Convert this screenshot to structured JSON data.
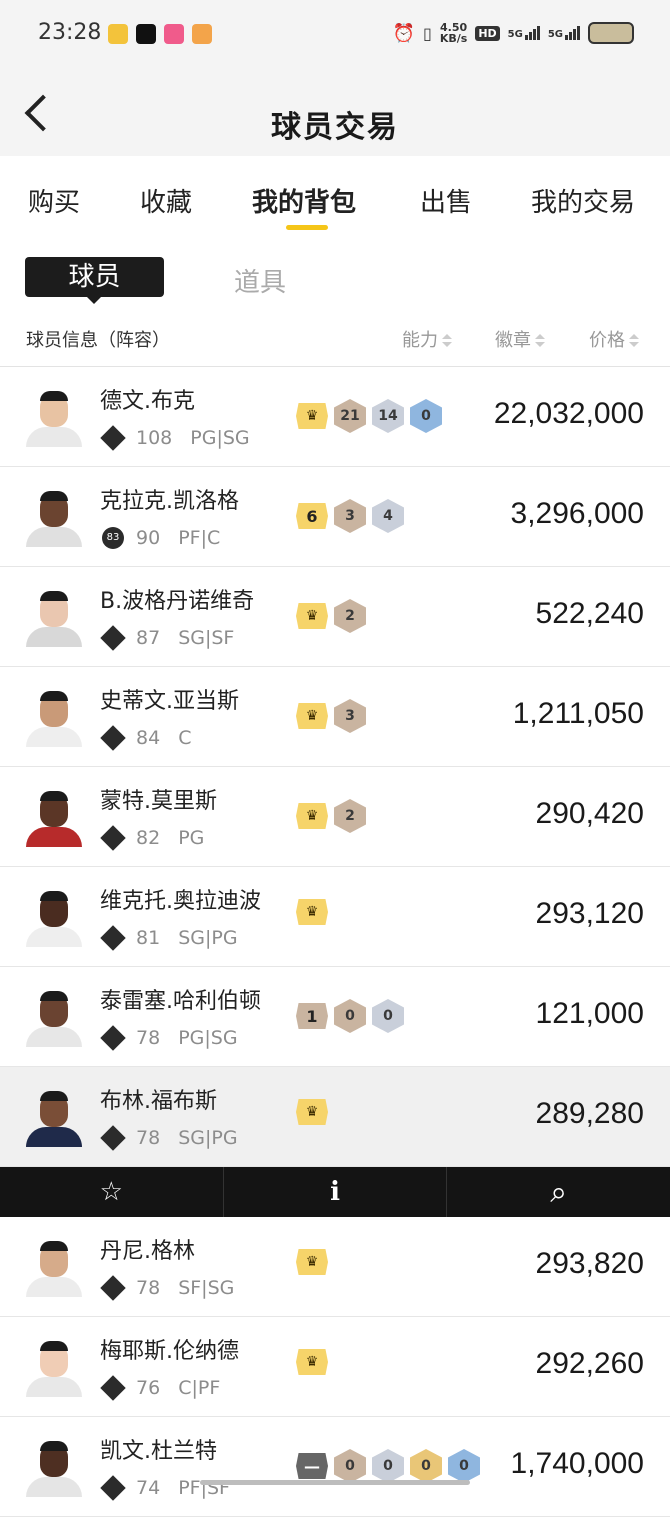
{
  "status_bar": {
    "time": "23:28",
    "net_speed_top": "4.50",
    "net_speed_bottom": "KB/s",
    "hd": "HD",
    "sim1": "5G",
    "sim2": "5G"
  },
  "header": {
    "title": "球员交易",
    "back_icon": "chevron-left-icon"
  },
  "tabs": [
    {
      "label": "购买"
    },
    {
      "label": "收藏"
    },
    {
      "label": "我的背包"
    },
    {
      "label": "出售"
    },
    {
      "label": "我的交易"
    }
  ],
  "active_tab": "我的背包",
  "subtabs": {
    "active": "球员",
    "inactive": "道具"
  },
  "columns": {
    "info": "球员信息（阵容）",
    "ability": "能力",
    "badge": "徽章",
    "price": "价格"
  },
  "players": [
    {
      "name": "德文.布克",
      "ovr": "108",
      "pos": "PG|SG",
      "badges": [
        {
          "k": "crown"
        },
        {
          "k": "hex",
          "c": "bronze",
          "v": "21"
        },
        {
          "k": "hex",
          "c": "silver",
          "v": "14"
        },
        {
          "k": "hex",
          "c": "blue",
          "v": "0"
        }
      ],
      "price": "22,032,000",
      "skin": "#e8c3a3",
      "jersey": "#e9e9e9"
    },
    {
      "name": "克拉克.凯洛格",
      "ovr": "90",
      "pos": "PF|C",
      "rank_round": "83",
      "badges": [
        {
          "k": "rank",
          "c": "gold",
          "v": "6"
        },
        {
          "k": "hex",
          "c": "bronze",
          "v": "3"
        },
        {
          "k": "hex",
          "c": "silver",
          "v": "4"
        }
      ],
      "price": "3,296,000",
      "skin": "#6b4430",
      "jersey": "#e0e0e0"
    },
    {
      "name": "B.波格丹诺维奇",
      "ovr": "87",
      "pos": "SG|SF",
      "badges": [
        {
          "k": "crown"
        },
        {
          "k": "hex",
          "c": "bronze",
          "v": "2"
        }
      ],
      "price": "522,240",
      "skin": "#eac7b0",
      "jersey": "#d8d8d8"
    },
    {
      "name": "史蒂文.亚当斯",
      "ovr": "84",
      "pos": "C",
      "badges": [
        {
          "k": "crown"
        },
        {
          "k": "hex",
          "c": "bronze",
          "v": "3"
        }
      ],
      "price": "1,211,050",
      "skin": "#c99a78",
      "jersey": "#eeeeee"
    },
    {
      "name": "蒙特.莫里斯",
      "ovr": "82",
      "pos": "PG",
      "badges": [
        {
          "k": "crown"
        },
        {
          "k": "hex",
          "c": "bronze",
          "v": "2"
        }
      ],
      "price": "290,420",
      "skin": "#5b3626",
      "jersey": "#b72b2b"
    },
    {
      "name": "维克托.奥拉迪波",
      "ovr": "81",
      "pos": "SG|PG",
      "badges": [
        {
          "k": "crown"
        }
      ],
      "price": "293,120",
      "skin": "#4a2c20",
      "jersey": "#eeeeee"
    },
    {
      "name": "泰雷塞.哈利伯顿",
      "ovr": "78",
      "pos": "PG|SG",
      "badges": [
        {
          "k": "rank",
          "c": "bronze",
          "v": "1"
        },
        {
          "k": "hex",
          "c": "bronze",
          "v": "0"
        },
        {
          "k": "hex",
          "c": "silver",
          "v": "0"
        }
      ],
      "price": "121,000",
      "skin": "#6a4331",
      "jersey": "#e7e7e7"
    },
    {
      "name": "布林.福布斯",
      "ovr": "78",
      "pos": "SG|PG",
      "badges": [
        {
          "k": "crown"
        }
      ],
      "price": "289,280",
      "skin": "#7a4e37",
      "jersey": "#1f2a4a"
    },
    {
      "name": "丹尼.格林",
      "ovr": "78",
      "pos": "SF|SG",
      "badges": [
        {
          "k": "crown"
        }
      ],
      "price": "293,820",
      "skin": "#d6ab8a",
      "jersey": "#ececec"
    },
    {
      "name": "梅耶斯.伦纳德",
      "ovr": "76",
      "pos": "C|PF",
      "badges": [
        {
          "k": "crown"
        }
      ],
      "price": "292,260",
      "skin": "#f0cdb5",
      "jersey": "#e8e8e8"
    },
    {
      "name": "凯文.杜兰特",
      "ovr": "74",
      "pos": "PF|SF",
      "badges": [
        {
          "k": "rank",
          "c": "dark",
          "v": "—"
        },
        {
          "k": "hex",
          "c": "bronze",
          "v": "0"
        },
        {
          "k": "hex",
          "c": "silver",
          "v": "0"
        },
        {
          "k": "hex",
          "c": "gold",
          "v": "0"
        },
        {
          "k": "hex",
          "c": "blue",
          "v": "0"
        }
      ],
      "price": "1,740,000",
      "skin": "#4e2f22",
      "jersey": "#e5e5e5"
    }
  ],
  "selected_index": 7,
  "action_bar": [
    {
      "icon": "star-icon",
      "glyph": "☆"
    },
    {
      "icon": "info-icon",
      "glyph": "i"
    },
    {
      "icon": "search-icon",
      "glyph": "⌕"
    }
  ],
  "colors": {
    "accent": "#f5c518",
    "action_bar": "#141414",
    "selected_row": "#f0f0f0"
  }
}
